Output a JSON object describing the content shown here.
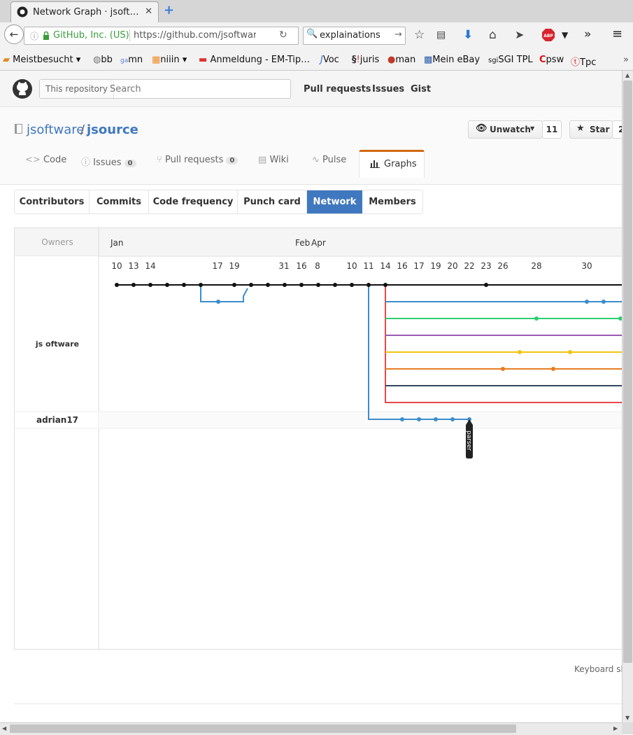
{
  "browser": {
    "tab_title": "Network Graph · jsoft…",
    "identity": "GitHub, Inc. (US)",
    "url": "https://github.com/jsoftware",
    "search_value": "explainations",
    "bookmarks": [
      "Meistbesucht",
      "bb",
      "mn",
      "niiin",
      "Anmeldung - EM-Tip…",
      "Voc",
      "juris",
      "man",
      "Mein eBay",
      "SGI TPL",
      "psw",
      "Tpc"
    ]
  },
  "header": {
    "search_scope": "This repository",
    "search_placeholder": "Search",
    "links": [
      "Pull requests",
      "Issues",
      "Gist"
    ]
  },
  "repo": {
    "owner": "jsoftware",
    "separator": "/",
    "name": "jsource",
    "unwatch_label": "Unwatch",
    "watch_count": "11",
    "star_label": "Star",
    "star_count": "2"
  },
  "repo_tabs": [
    {
      "label": "Code",
      "count": ""
    },
    {
      "label": "Issues",
      "count": "0"
    },
    {
      "label": "Pull requests",
      "count": "0"
    },
    {
      "label": "Wiki",
      "count": ""
    },
    {
      "label": "Pulse",
      "count": ""
    },
    {
      "label": "Graphs",
      "count": ""
    }
  ],
  "graph_tabs": [
    "Contributors",
    "Commits",
    "Code frequency",
    "Punch card",
    "Network",
    "Members"
  ],
  "active_graph_tab": "Network",
  "network": {
    "owners_header": "Owners",
    "months": [
      "Jan",
      "Feb",
      "Apr"
    ],
    "days": [
      "10",
      "13",
      "14",
      "17",
      "19",
      "31",
      "16",
      "8",
      "10",
      "11",
      "14",
      "16",
      "17",
      "19",
      "20",
      "22",
      "23",
      "26",
      "28",
      "30"
    ],
    "owners": [
      "js oftware",
      "adrian17"
    ],
    "branch_label": "parser"
  },
  "footer": {
    "keyboard_shortcuts": "Keyboard sh"
  },
  "colors": {
    "accent": "#4078c0",
    "active_tab_border": "#d26911",
    "branch_black": "#111111",
    "branch_blue": "#3c8dcb",
    "branch_red": "#e8474c",
    "branch_green": "#2ecc71",
    "branch_purple": "#9b59b6",
    "branch_yellow": "#f1c40f",
    "branch_orange": "#e67e22",
    "branch_navy": "#34495e"
  }
}
